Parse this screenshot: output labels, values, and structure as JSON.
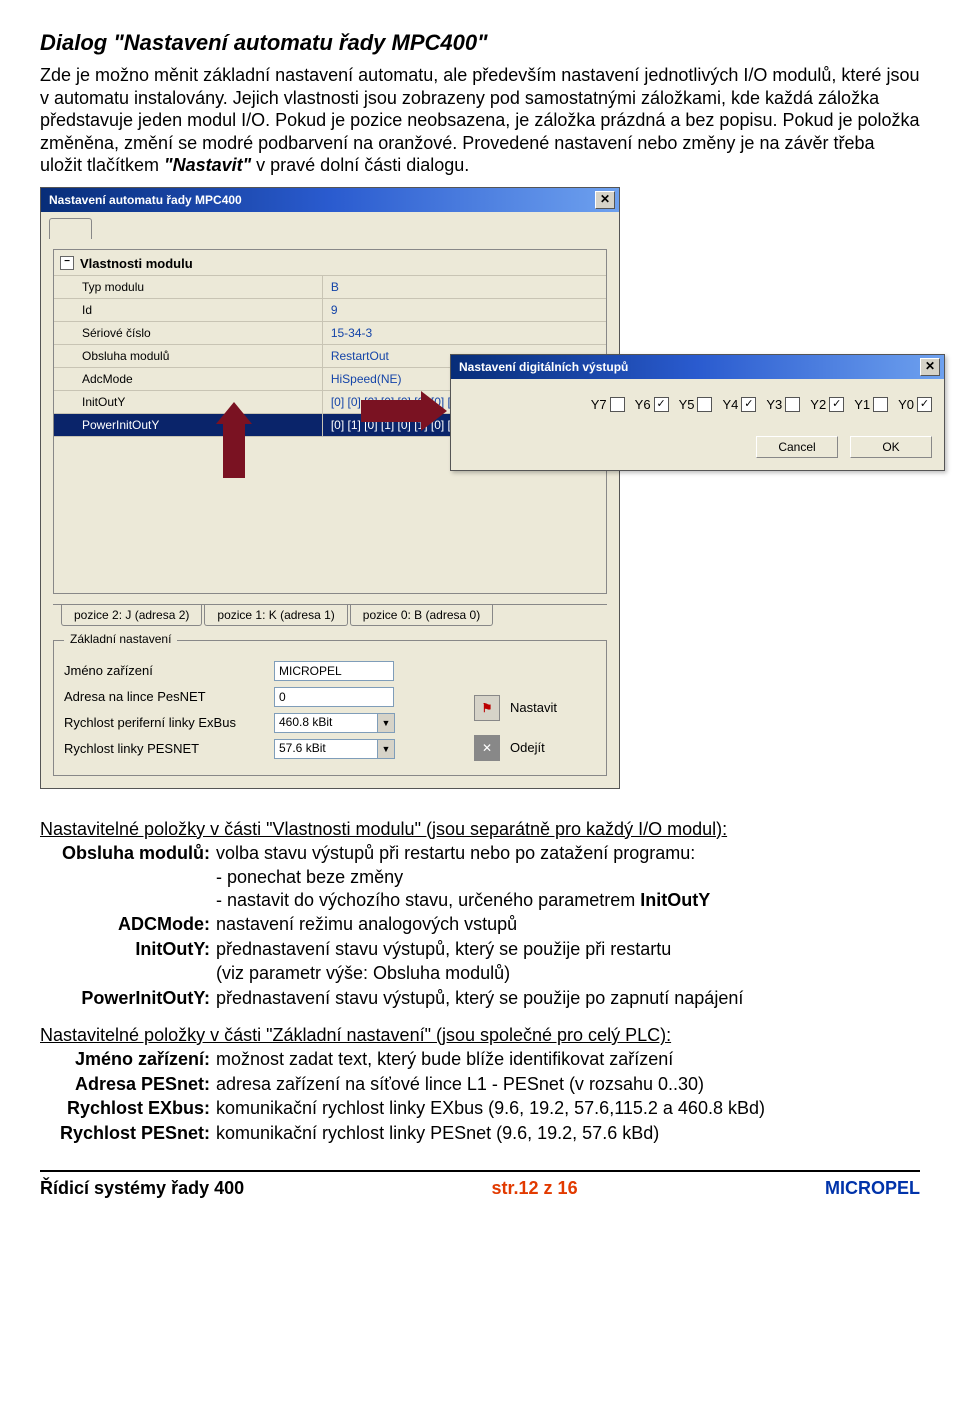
{
  "heading": "Dialog \"Nastavení automatu řady MPC400\"",
  "intro": "Zde je možno měnit základní nastavení automatu, ale především nastavení jednotlivých I/O modulů, které jsou v automatu instalovány. Jejich vlastnosti jsou zobrazeny pod samostatnými záložkami, kde každá záložka představuje jeden modul I/O. Pokud je pozice neobsazena, je záložka prázdná a bez popisu. Pokud je položka změněna, změní se modré podbarvení na oranžové. Provedené nastavení nebo změny je na závěr třeba uložit tlačítkem ",
  "intro_em": "\"Nastavit\"",
  "intro_tail": " v pravé dolní části dialogu.",
  "dialog": {
    "title": "Nastavení automatu řady MPC400",
    "group_title": "Vlastnosti modulu",
    "rows": [
      {
        "label": "Typ modulu",
        "value": "B"
      },
      {
        "label": "Id",
        "value": "9"
      },
      {
        "label": "Sériové číslo",
        "value": "15-34-3"
      },
      {
        "label": "Obsluha modulů",
        "value": "RestartOut"
      },
      {
        "label": "AdcMode",
        "value": "HiSpeed(NE)"
      },
      {
        "label": "InitOutY",
        "value": "[0] [0] [0] [0] [0] [0] [0] [0]"
      },
      {
        "label": "PowerInitOutY",
        "value": "[0] [1] [0] [1] [0] [1] [0] [1]"
      }
    ],
    "foot_tabs": [
      "pozice 2: J (adresa 2)",
      "pozice 1: K (adresa 1)",
      "pozice 0: B (adresa 0)"
    ],
    "group2_label": "Základní nastavení",
    "f_name_l": "Jméno zařízení",
    "f_name_v": "MICROPEL",
    "f_addr_l": "Adresa na lince PesNET",
    "f_addr_v": "0",
    "f_exbus_l": "Rychlost periferní linky ExBus",
    "f_exbus_v": "460.8 kBit",
    "f_pesnet_l": "Rychlost linky PESNET",
    "f_pesnet_v": "57.6 kBit",
    "btn_set": "Nastavit",
    "btn_exit": "Odejít"
  },
  "popup": {
    "title": "Nastavení digitálních výstupů",
    "y": [
      "Y7",
      "Y6",
      "Y5",
      "Y4",
      "Y3",
      "Y2",
      "Y1",
      "Y0"
    ],
    "chk": [
      false,
      true,
      false,
      true,
      false,
      true,
      false,
      true
    ],
    "btn_cancel": "Cancel",
    "btn_ok": "OK"
  },
  "defs": {
    "head1": "Nastavitelné položky v části \"Vlastnosti modulu\" (jsou separátně pro každý I/O modul):",
    "obsluha_t": "Obsluha modulů:",
    "obsluha_d1": "volba stavu výstupů při restartu nebo po zatažení programu:",
    "obsluha_d2": "- ponechat beze změny",
    "obsluha_d3a": "- nastavit do výchozího stavu, určeného parametrem ",
    "obsluha_d3b": "InitOutY",
    "adc_t": "ADCMode:",
    "adc_d": "nastavení režimu analogových vstupů",
    "init_t": "InitOutY:",
    "init_d1": "přednastavení stavu výstupů, který se použije při restartu",
    "init_d2": "(viz parametr výše: Obsluha modulů)",
    "power_t": "PowerInitOutY:",
    "power_d": "přednastavení stavu výstupů, který se použije po zapnutí napájení",
    "head2": "Nastavitelné položky v části \"Základní nastavení\" (jsou společné pro celý PLC):",
    "jmeno_t": "Jméno zařízení:",
    "jmeno_d": "možnost zadat text, který bude blíže identifikovat zařízení",
    "adresa_t": "Adresa PESnet:",
    "adresa_d": "adresa zařízení na síťové lince L1 - PESnet (v rozsahu 0..30)",
    "exbus_t": "Rychlost EXbus:",
    "exbus_d": "komunikační rychlost linky EXbus (9.6, 19.2, 57.6,115.2 a 460.8 kBd)",
    "pesnet_t": "Rychlost PESnet:",
    "pesnet_d": "komunikační rychlost linky PESnet (9.6, 19.2, 57.6 kBd)"
  },
  "footer": {
    "left": "Řídicí systémy řady 400",
    "mid": "str.12 z 16",
    "right": "MICROPEL"
  }
}
